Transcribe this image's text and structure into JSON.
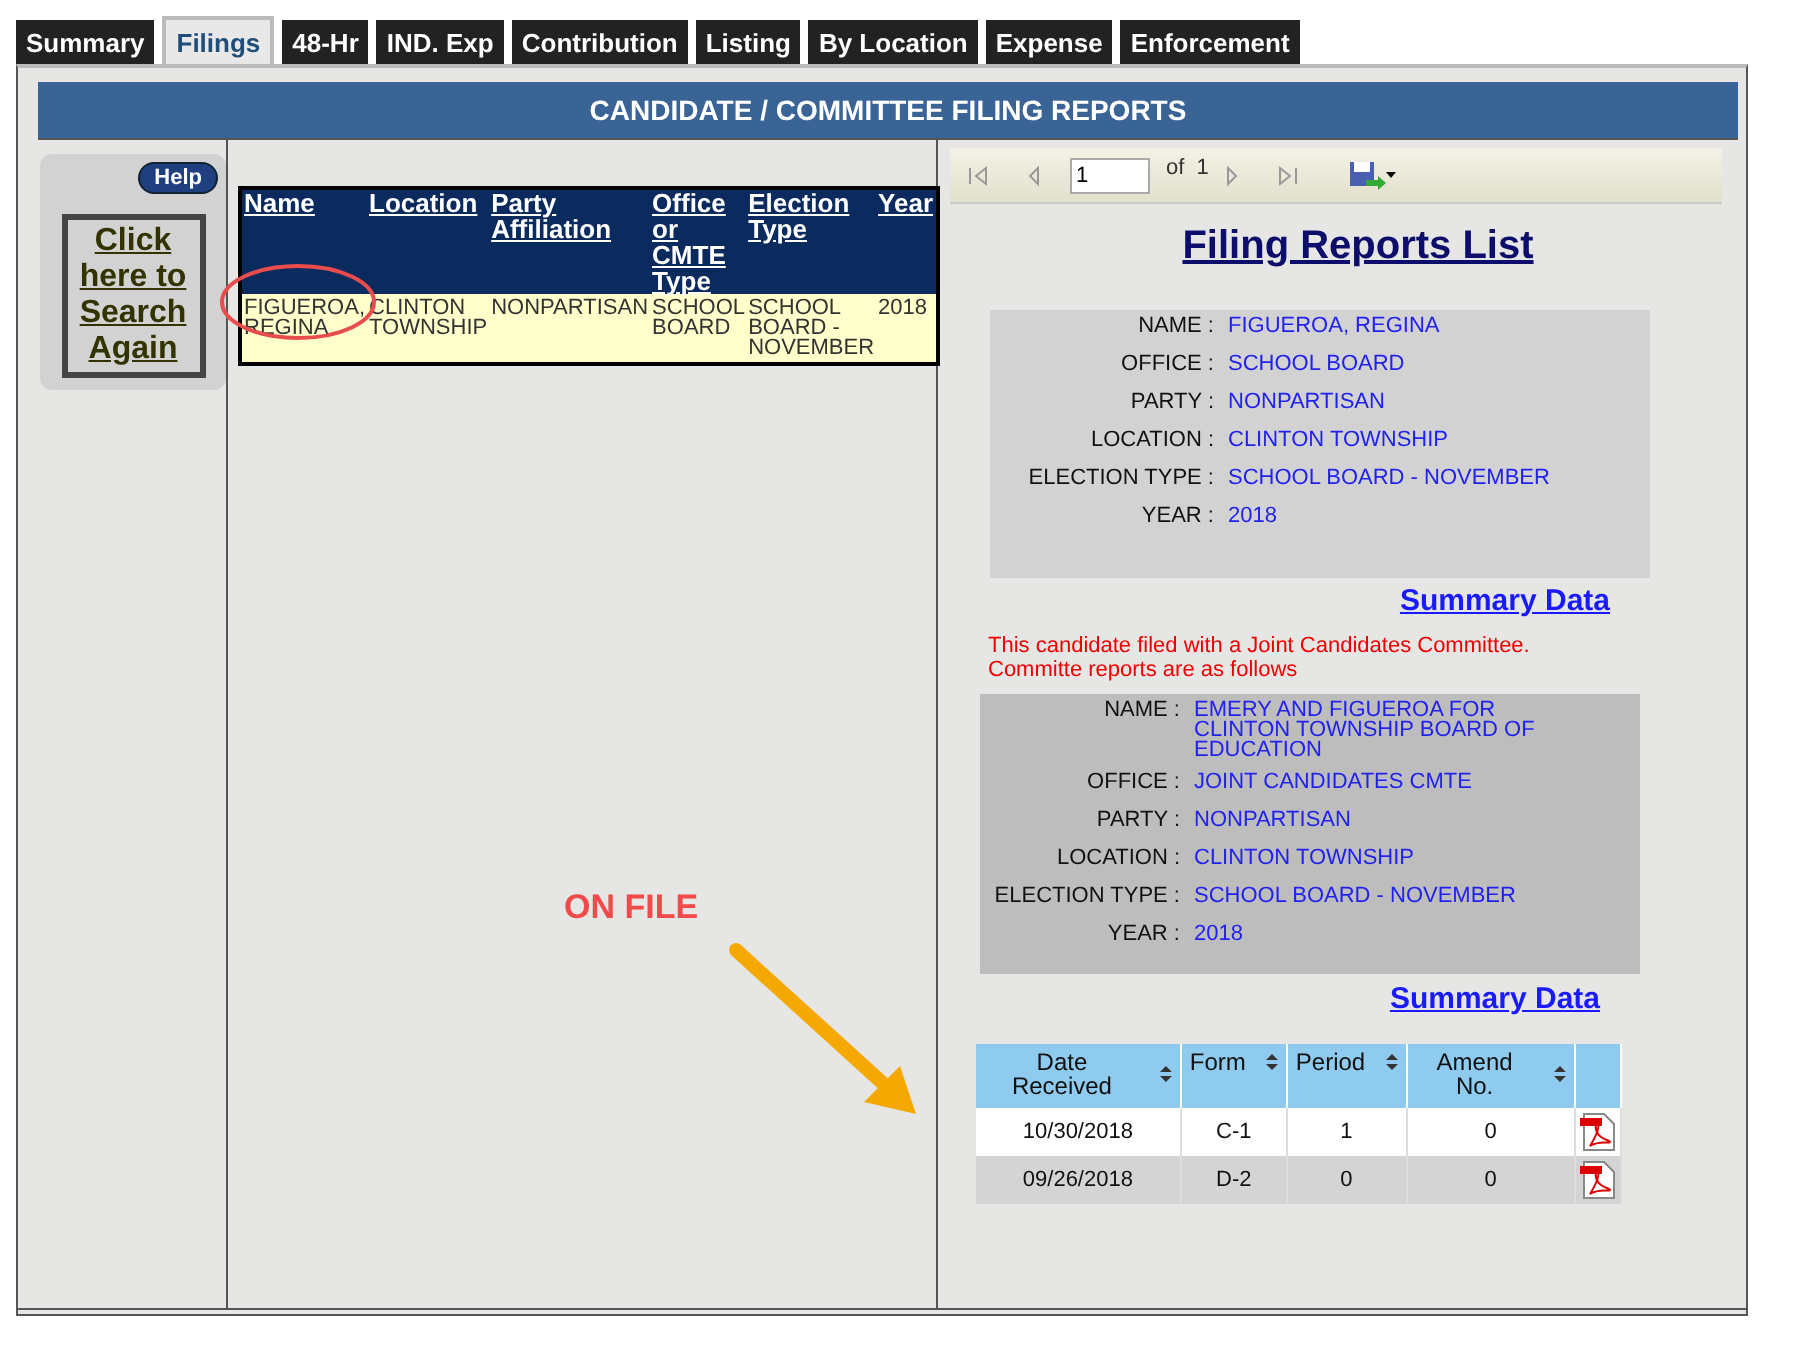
{
  "tabs": [
    {
      "label": "Summary",
      "selected": false
    },
    {
      "label": "Filings",
      "selected": true
    },
    {
      "label": "48-Hr",
      "selected": false
    },
    {
      "label": "IND. Exp",
      "selected": false
    },
    {
      "label": "Contribution",
      "selected": false
    },
    {
      "label": "Listing",
      "selected": false
    },
    {
      "label": "By Location",
      "selected": false
    },
    {
      "label": "Expense",
      "selected": false
    },
    {
      "label": "Enforcement",
      "selected": false
    }
  ],
  "header": "CANDIDATE / COMMITTEE FILING REPORTS",
  "sidebar": {
    "help": "Help",
    "search_again": "Click here to Search Again"
  },
  "results_table": {
    "columns": [
      "Name",
      "Location",
      "Party Affiliation",
      "Office or CMTE Type",
      "Election Type",
      "Year"
    ],
    "rows": [
      {
        "cells": [
          "FIGUEROA, REGINA",
          "CLINTON TOWNSHIP",
          "NONPARTISAN",
          "SCHOOL BOARD",
          "SCHOOL BOARD - NOVEMBER",
          "2018"
        ]
      }
    ]
  },
  "report_toolbar": {
    "page": "1",
    "of": "of",
    "total": "1"
  },
  "report": {
    "title": "Filing Reports List",
    "candidate": [
      {
        "label": "NAME :",
        "value": "FIGUEROA, REGINA"
      },
      {
        "label": "OFFICE :",
        "value": "SCHOOL BOARD"
      },
      {
        "label": "PARTY :",
        "value": "NONPARTISAN"
      },
      {
        "label": "LOCATION :",
        "value": "CLINTON TOWNSHIP"
      },
      {
        "label": "ELECTION TYPE :",
        "value": "SCHOOL BOARD - NOVEMBER"
      },
      {
        "label": "YEAR :",
        "value": "2018"
      }
    ],
    "summary_link": "Summary Data",
    "notice": "This candidate filed with a Joint Candidates Committee. Committe reports are as follows",
    "committee": [
      {
        "label": "NAME :",
        "value": "EMERY AND FIGUEROA FOR CLINTON TOWNSHIP BOARD OF EDUCATION"
      },
      {
        "label": "OFFICE :",
        "value": "JOINT CANDIDATES CMTE"
      },
      {
        "label": "PARTY :",
        "value": "NONPARTISAN"
      },
      {
        "label": "LOCATION :",
        "value": "CLINTON TOWNSHIP"
      },
      {
        "label": "ELECTION TYPE :",
        "value": "SCHOOL BOARD - NOVEMBER"
      },
      {
        "label": "YEAR :",
        "value": "2018"
      }
    ],
    "committee_summary_link": "Summary Data",
    "filings": {
      "columns": [
        "Date Received",
        "Form",
        "Period",
        "Amend No."
      ],
      "rows": [
        {
          "cells": [
            "10/30/2018",
            "C-1",
            "1",
            "0"
          ]
        },
        {
          "cells": [
            "09/26/2018",
            "D-2",
            "0",
            "0"
          ]
        }
      ]
    }
  },
  "annotation": {
    "text": "ON FILE"
  }
}
